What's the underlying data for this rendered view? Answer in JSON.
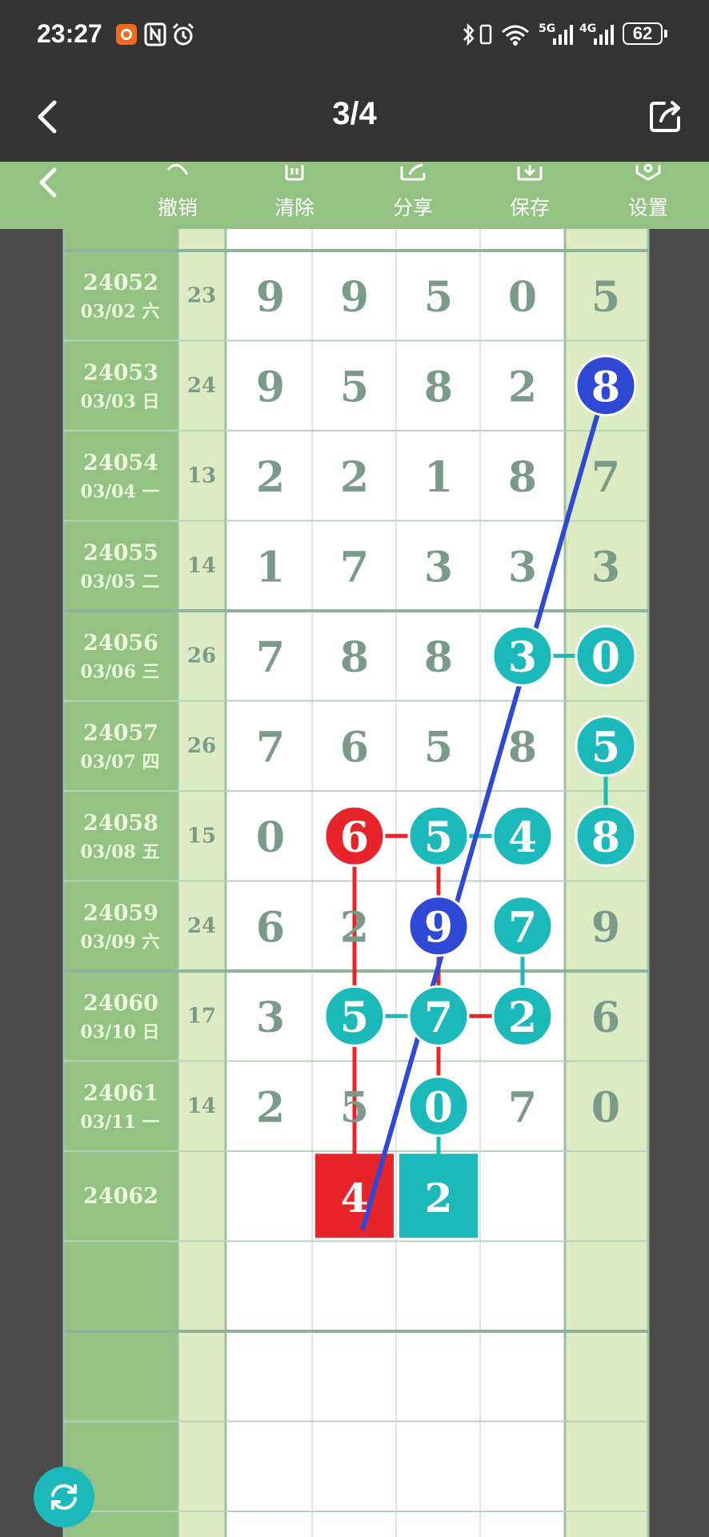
{
  "status_bar": {
    "time": "23:27",
    "icons": [
      "app-notification-icon",
      "nfc-icon",
      "alarm-icon",
      "bluetooth-icon",
      "vibrate-icon",
      "wifi-icon",
      "5g-signal-icon",
      "4g-signal-icon"
    ],
    "network_5g": "5G",
    "network_4g": "4G",
    "battery": "62"
  },
  "header": {
    "page_counter": "3/4",
    "icons": [
      "back-arrow-icon",
      "share-icon"
    ]
  },
  "toolbar": {
    "undo_label": "撤销",
    "clear_label": "清除",
    "share_label": "分享",
    "save_label": "保存",
    "settings_label": "设置",
    "icons": [
      "back-icon",
      "undo-icon",
      "trash-icon",
      "share-icon",
      "save-icon",
      "settings-icon"
    ]
  },
  "colors": {
    "panel_green": "#93c283",
    "light_green": "#dcebc2",
    "digit_gray": "#7a9a8a",
    "teal": "#1bb9b9",
    "red": "#e8242b",
    "blue": "#2f49d4"
  },
  "chart_data": {
    "type": "table",
    "rows": [
      {
        "id": "24052",
        "date": "03/02 六",
        "sum": "23",
        "digits": [
          "9",
          "9",
          "5",
          "0",
          "5"
        ]
      },
      {
        "id": "24053",
        "date": "03/03 日",
        "sum": "24",
        "digits": [
          "9",
          "5",
          "8",
          "2",
          "8"
        ]
      },
      {
        "id": "24054",
        "date": "03/04 一",
        "sum": "13",
        "digits": [
          "2",
          "2",
          "1",
          "8",
          "7"
        ]
      },
      {
        "id": "24055",
        "date": "03/05 二",
        "sum": "14",
        "digits": [
          "1",
          "7",
          "3",
          "3",
          "3"
        ]
      },
      {
        "id": "24056",
        "date": "03/06 三",
        "sum": "26",
        "digits": [
          "7",
          "8",
          "8",
          "3",
          "0"
        ]
      },
      {
        "id": "24057",
        "date": "03/07 四",
        "sum": "26",
        "digits": [
          "7",
          "6",
          "5",
          "8",
          "5"
        ]
      },
      {
        "id": "24058",
        "date": "03/08 五",
        "sum": "15",
        "digits": [
          "0",
          "6",
          "5",
          "4",
          "8"
        ]
      },
      {
        "id": "24059",
        "date": "03/09 六",
        "sum": "24",
        "digits": [
          "6",
          "2",
          "9",
          "7",
          "9"
        ]
      },
      {
        "id": "24060",
        "date": "03/10 日",
        "sum": "17",
        "digits": [
          "3",
          "5",
          "7",
          "2",
          "6"
        ]
      },
      {
        "id": "24061",
        "date": "03/11 一",
        "sum": "14",
        "digits": [
          "2",
          "5",
          "0",
          "7",
          "0"
        ]
      },
      {
        "id": "24062",
        "date": "",
        "sum": "",
        "digits": [
          "",
          "",
          "",
          "",
          ""
        ]
      }
    ],
    "circles": [
      {
        "row": 1,
        "col": 4,
        "color": "blue"
      },
      {
        "row": 4,
        "col": 3,
        "color": "teal"
      },
      {
        "row": 4,
        "col": 4,
        "color": "teal"
      },
      {
        "row": 5,
        "col": 4,
        "color": "teal"
      },
      {
        "row": 6,
        "col": 1,
        "color": "red"
      },
      {
        "row": 6,
        "col": 2,
        "color": "teal"
      },
      {
        "row": 6,
        "col": 3,
        "color": "teal"
      },
      {
        "row": 6,
        "col": 4,
        "color": "teal"
      },
      {
        "row": 7,
        "col": 2,
        "color": "blue"
      },
      {
        "row": 7,
        "col": 3,
        "color": "teal"
      },
      {
        "row": 8,
        "col": 1,
        "color": "teal"
      },
      {
        "row": 8,
        "col": 2,
        "color": "teal"
      },
      {
        "row": 8,
        "col": 3,
        "color": "teal"
      },
      {
        "row": 9,
        "col": 2,
        "color": "teal"
      }
    ],
    "links": [
      {
        "from": [
          4,
          3
        ],
        "to": [
          4,
          4
        ],
        "color": "teal"
      },
      {
        "from": [
          5,
          4
        ],
        "to": [
          6,
          4
        ],
        "color": "teal"
      },
      {
        "from": [
          6,
          1
        ],
        "to": [
          6,
          2
        ],
        "color": "red"
      },
      {
        "from": [
          6,
          2
        ],
        "to": [
          6,
          3
        ],
        "color": "teal"
      },
      {
        "from": [
          7,
          3
        ],
        "to": [
          8,
          3
        ],
        "color": "teal"
      },
      {
        "from": [
          8,
          1
        ],
        "to": [
          8,
          2
        ],
        "color": "teal"
      },
      {
        "from": [
          8,
          2
        ],
        "to": [
          8,
          3
        ],
        "color": "red"
      },
      {
        "from": [
          6,
          1
        ],
        "to": [
          10,
          1
        ],
        "color": "red"
      },
      {
        "from": [
          6,
          2
        ],
        "to": [
          10,
          2
        ],
        "color": "red"
      },
      {
        "from": [
          9,
          2
        ],
        "to": [
          10,
          2
        ],
        "color": "teal"
      }
    ],
    "trend_line": {
      "from": [
        1,
        4
      ],
      "to": [
        10,
        1
      ],
      "color": "blue"
    },
    "marked_boxes": [
      {
        "row": 10,
        "col": 1,
        "color": "red",
        "value": "4"
      },
      {
        "row": 10,
        "col": 2,
        "color": "teal",
        "value": "2"
      }
    ]
  }
}
